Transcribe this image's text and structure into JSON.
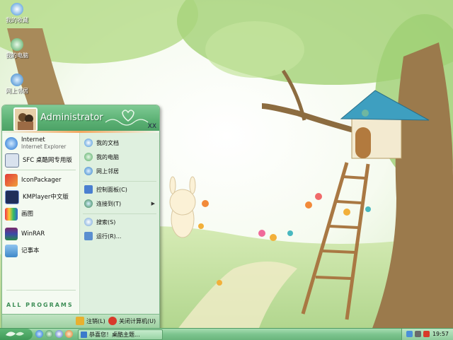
{
  "desktop": {
    "icons": [
      {
        "label": "我的收藏",
        "icon": "favorites-icon"
      },
      {
        "label": "我的电脑",
        "icon": "my-computer-icon"
      },
      {
        "label": "网上邻居",
        "icon": "network-icon"
      }
    ]
  },
  "start_menu": {
    "user": "Administrator",
    "header_tag": "XX",
    "pinned": [
      {
        "name": "Internet",
        "sub": "Internet Explorer",
        "icon": "ie-icon"
      },
      {
        "name": "SFC 桌酷网专用版",
        "sub": "",
        "icon": "sfc-icon"
      }
    ],
    "recent": [
      {
        "name": "IconPackager",
        "icon": "iconpackager-icon"
      },
      {
        "name": "KMPlayer中文版",
        "icon": "kmplayer-icon"
      },
      {
        "name": "画图",
        "icon": "paint-icon"
      },
      {
        "name": "WinRAR",
        "icon": "winrar-icon"
      },
      {
        "name": "记事本",
        "icon": "notepad-icon"
      }
    ],
    "all_programs": "ALL PROGRAMS",
    "places": [
      {
        "name": "我的文档",
        "icon": "documents-icon",
        "arrow": false
      },
      {
        "name": "我的电脑",
        "icon": "computer-icon",
        "arrow": false
      },
      {
        "name": "网上邻居",
        "icon": "network-icon",
        "arrow": false
      },
      {
        "name": "控制面板(C)",
        "icon": "control-panel-icon",
        "arrow": false
      },
      {
        "name": "连接到(T)",
        "icon": "connect-icon",
        "arrow": true
      },
      {
        "name": "搜索(S)",
        "icon": "search-icon",
        "arrow": false
      },
      {
        "name": "运行(R)...",
        "icon": "run-icon",
        "arrow": false
      }
    ],
    "logoff": "注销(L)",
    "shutdown": "关闭计算机(U)"
  },
  "taskbar": {
    "task_label": "恭喜您！桌酷主题...",
    "clock": "19:57"
  },
  "colors": {
    "accent": "#5bb174",
    "menu_bg": "#eef5ea",
    "taskbar": "#7cc48e"
  }
}
